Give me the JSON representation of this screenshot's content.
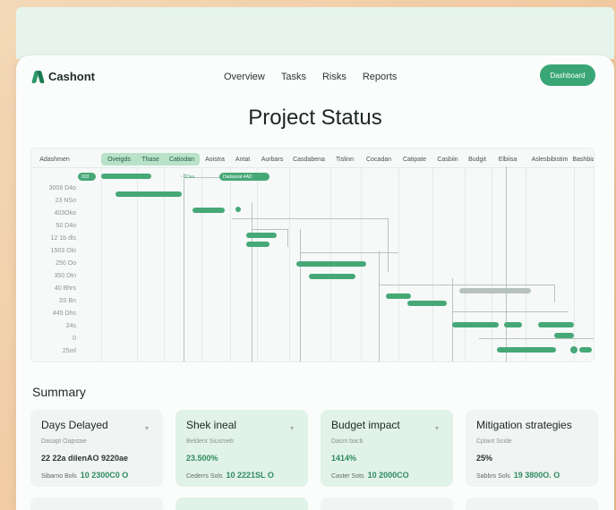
{
  "app": {
    "brand": "Cashont",
    "cta": "Dashboard"
  },
  "nav": {
    "links": [
      "Overview",
      "Tasks",
      "Risks",
      "Reports"
    ]
  },
  "page": {
    "title": "Project Status"
  },
  "gantt": {
    "columns": [
      "Adashmen",
      "Oveigds",
      "Thase",
      "Catiodan",
      "Aoistra",
      "Antat",
      "Aurbars",
      "Casdabena",
      "Tislinn",
      "Cocadan",
      "Catipate",
      "Casbiin",
      "Budgit",
      "Elbiisa",
      "Aslesbibistim",
      "Bashbia"
    ],
    "active_columns": [
      1,
      2,
      3
    ],
    "rows": [
      "",
      "3008 D4o",
      "23 NSo",
      "403Oko",
      "50 D4o",
      "12 1b dls",
      "1503 Olo",
      "250 Oo",
      "350 Dtn",
      "40 Bhrs",
      "3S Bn",
      "445 Dhs",
      "24s",
      "0",
      "25ml"
    ],
    "pills": [
      "003",
      "~ 6Daa",
      "Dadasnat 4AD"
    ],
    "colors": {
      "accent": "#46a877",
      "grid": "#e3eae7",
      "connector": "#b9c4bf"
    }
  },
  "summary": {
    "title": "Summary",
    "cards": [
      {
        "title": "Days Delayed",
        "sub": "Dasapt Oapstae",
        "value": "22 22a dilenAO 9220ae",
        "foot_label": "Sibarno Bols",
        "foot_value": "10 2300C0 O",
        "green": false
      },
      {
        "title": "Shek ineal",
        "sub": "Beldent Siusmeb",
        "value": "23.500%",
        "foot_label": "Cederrs Sols",
        "foot_value": "10 2221SL O",
        "green": false
      },
      {
        "title": "Budget impact",
        "sub": "Dasnt bacb",
        "value": "1414%",
        "foot_label": "Caster Sots",
        "foot_value": "10 2000CO",
        "green": true
      },
      {
        "title": "Mitigation strategies",
        "sub": "Cplant Scide",
        "value": "25%",
        "foot_label": "Sabbrs Sols",
        "foot_value": "19 3800O. O",
        "green": false
      }
    ]
  }
}
